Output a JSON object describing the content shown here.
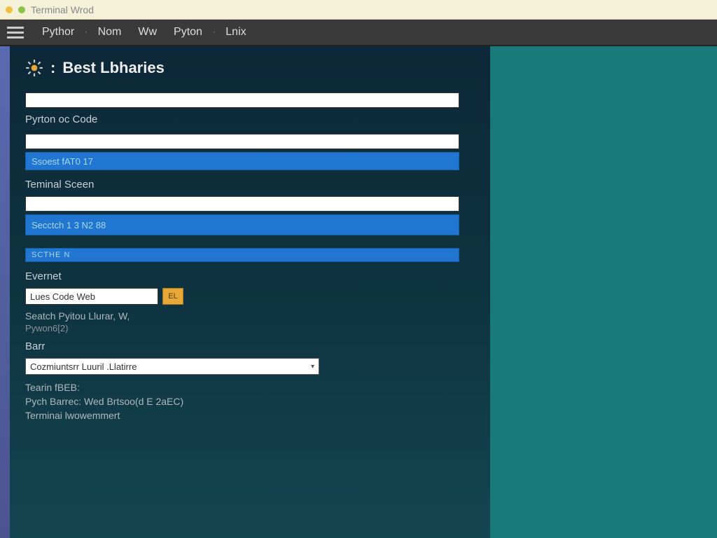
{
  "window": {
    "title": "Terminal Wrod"
  },
  "menubar": {
    "items": [
      "Pythor",
      "Nom",
      "Ww",
      "Pyton",
      "Lnix"
    ]
  },
  "page": {
    "title": "Best Lbharies"
  },
  "sections": {
    "pythonCode": {
      "label": "Pyrton oc Code",
      "result": "Ssoest fAT0 17"
    },
    "terminalScreen": {
      "label": "Teminal Sceen",
      "result": "Secctch 1 3 N2 88"
    },
    "smallBar": "SCTHE N",
    "event": {
      "label": "Evernet",
      "inputValue": "Lues Code Web",
      "btn": "EL"
    },
    "search": {
      "line1": "Seatch Pyitou Llurar, W,",
      "line2": "Pywon6[2)"
    },
    "bar": {
      "label": "Barr",
      "selectValue": "Cozmiuntsrr Luuril .Llatirre"
    },
    "footer": {
      "line1": "Tearin fBEB:",
      "line2": "Pych Barrec: Wed Brtsoo(d E 2aEC)",
      "line3": "Terminai lwowemmert"
    }
  }
}
